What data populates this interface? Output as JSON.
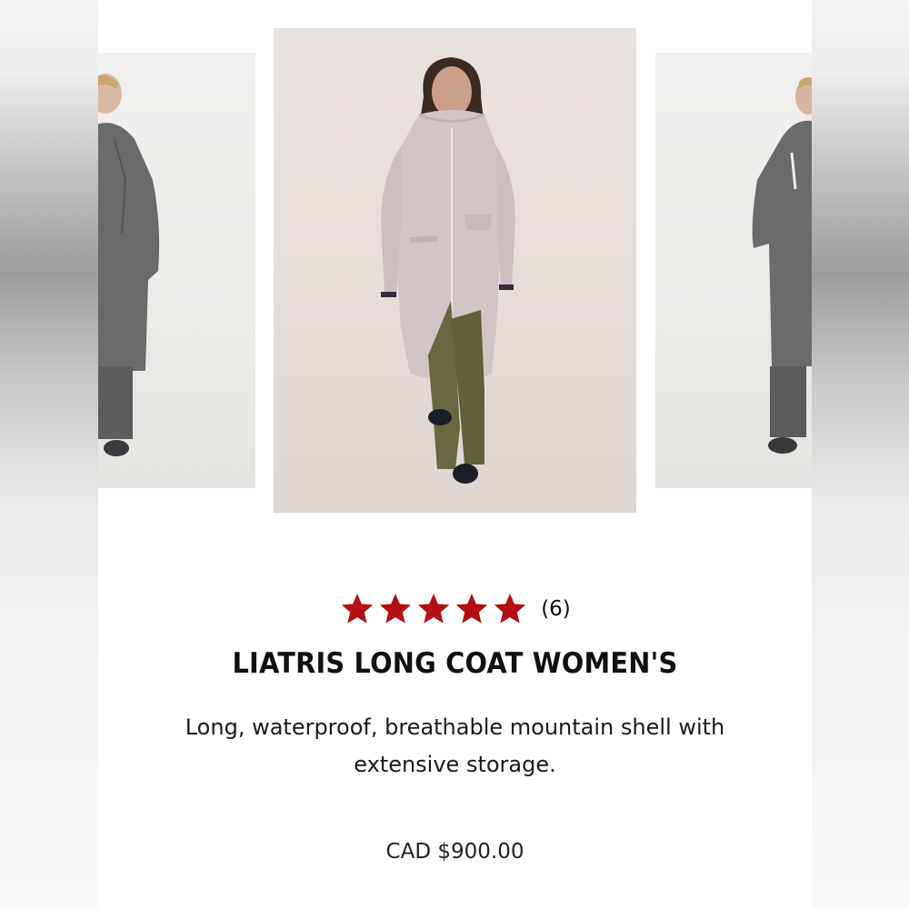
{
  "product": {
    "rating": {
      "stars": 5,
      "max_stars": 5,
      "count_label": "(6)"
    },
    "title": "LIATRIS LONG COAT WOMEN'S",
    "description": "Long, waterproof, breathable mountain shell with extensive storage.",
    "price": "CAD $900.00"
  },
  "gallery": {
    "images": [
      {
        "name": "left-model-photo",
        "subject": "model in grey long coat"
      },
      {
        "name": "main-model-photo",
        "subject": "model in light grey long coat with olive pants"
      },
      {
        "name": "right-model-photo",
        "subject": "model in grey long coat"
      }
    ]
  },
  "colors": {
    "star": "#b40f12",
    "text": "#111111"
  }
}
